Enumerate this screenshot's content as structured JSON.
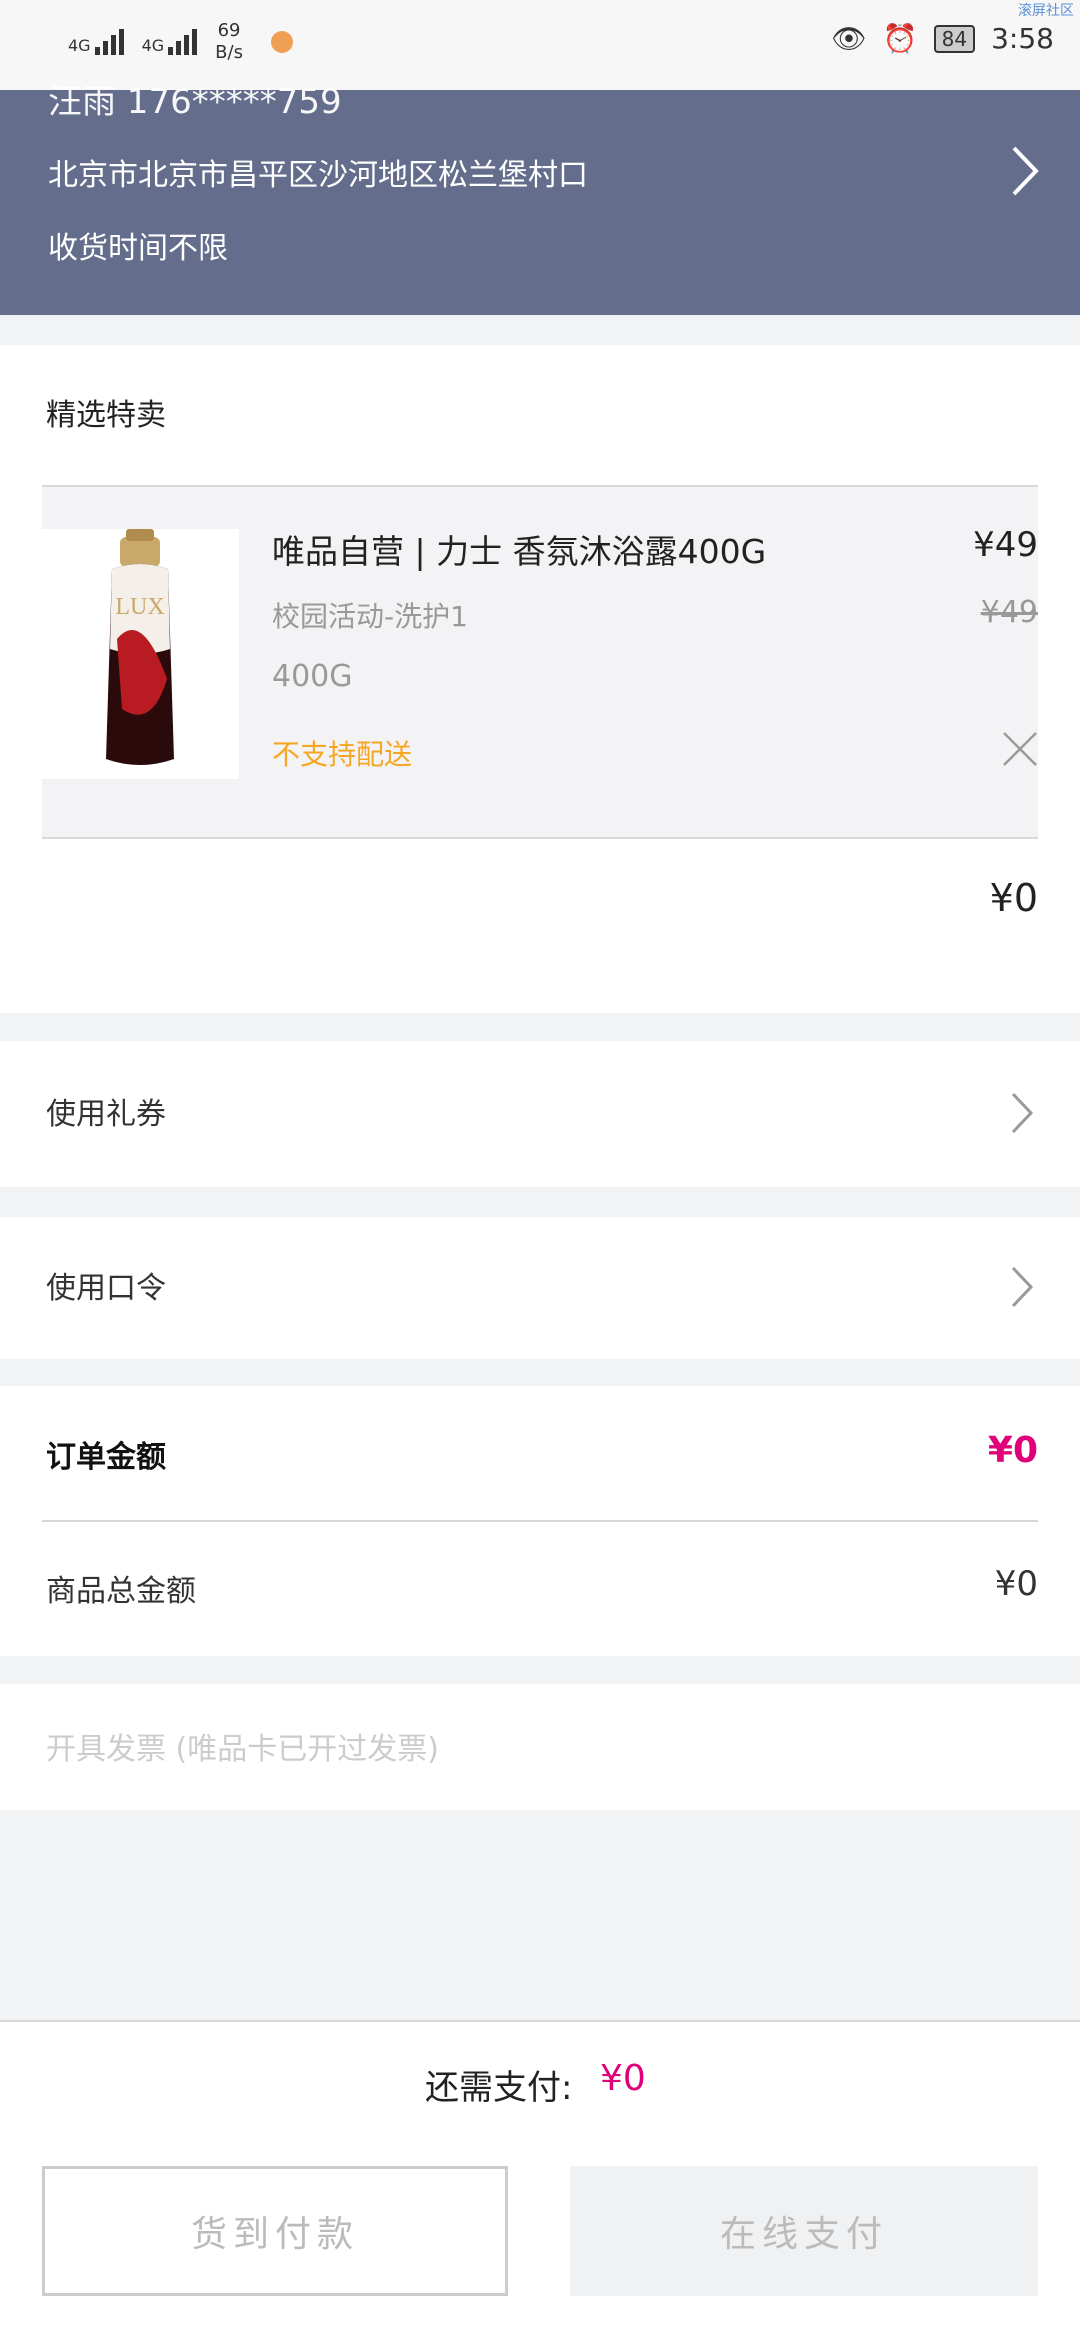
{
  "status_bar": {
    "net_speed_value": "69",
    "net_speed_unit": "B/s",
    "signal_label": "4G",
    "battery": "84",
    "time": "3:58",
    "corner_tag": "滚屏社区"
  },
  "address": {
    "name_phone": "汪雨     176*****759",
    "address": "北京市北京市昌平区沙河地区松兰堡村口",
    "delivery_time": "收货时间不限"
  },
  "section": {
    "title": "精选特卖"
  },
  "product": {
    "name": "唯品自营 | 力士 香氛沐浴露400G",
    "tag": "校园活动-洗护1",
    "spec": "400G",
    "warning": "不支持配送",
    "price": "¥49",
    "original_price": "¥49",
    "image_label": "LUX"
  },
  "section_total": "¥0",
  "coupon": {
    "label": "使用礼券"
  },
  "password": {
    "label": "使用口令"
  },
  "order": {
    "label": "订单金额",
    "amount": "¥0",
    "goods_label": "商品总金额",
    "goods_amount": "¥0"
  },
  "invoice": {
    "label": "开具发票 (唯品卡已开过发票)"
  },
  "bottom": {
    "pay_label": "还需支付:",
    "pay_amount": "¥0",
    "cod_button": "货到付款",
    "online_button": "在线支付"
  },
  "colors": {
    "header_bg": "#646d8b",
    "accent_pink": "#e0007a",
    "warning_orange": "#f5a623"
  }
}
